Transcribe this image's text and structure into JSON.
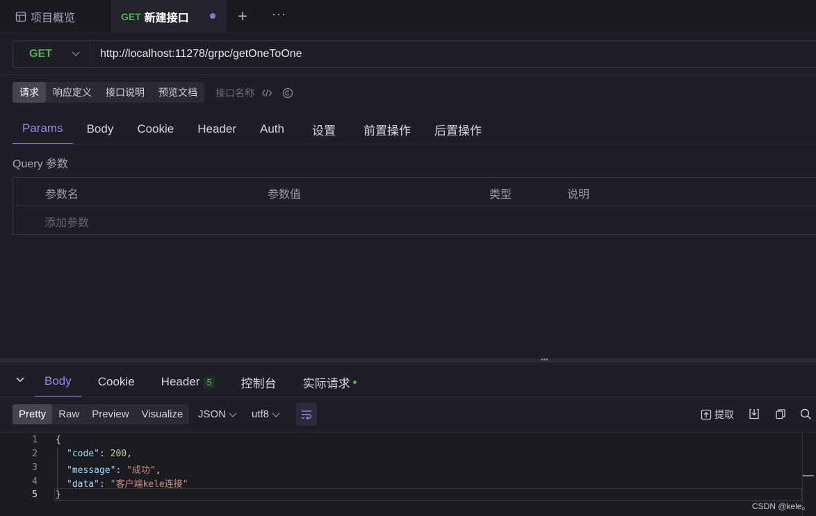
{
  "tabs": {
    "overview_label": "项目概览",
    "active_method": "GET",
    "active_name": "新建接口",
    "add_label": "+",
    "more_label": "···"
  },
  "request": {
    "method": "GET",
    "url": "http://localhost:11278/grpc/getOneToOne"
  },
  "segments": [
    "请求",
    "响应定义",
    "接口说明",
    "预览文档"
  ],
  "interface_name_placeholder": "接口名称",
  "param_tabs": [
    "Params",
    "Body",
    "Cookie",
    "Header",
    "Auth",
    "设置",
    "前置操作",
    "后置操作"
  ],
  "query_label": "Query 参数",
  "table": {
    "headers": [
      "参数名",
      "参数值",
      "类型",
      "说明"
    ],
    "add_placeholder": "添加参数"
  },
  "response": {
    "tabs": [
      "Body",
      "Cookie",
      "Header",
      "控制台",
      "实际请求"
    ],
    "header_count": "5",
    "format_tabs": [
      "Pretty",
      "Raw",
      "Preview",
      "Visualize"
    ],
    "format": "JSON",
    "encoding": "utf8",
    "extract_label": "提取",
    "lines": [
      "1",
      "2",
      "3",
      "4",
      "5"
    ],
    "code": {
      "open": "{",
      "k1": "\"code\"",
      "v1": "200",
      "k2": "\"message\"",
      "v2": "\"成功\"",
      "k3": "\"data\"",
      "v3": "\"客户端kele连接\"",
      "close": "}"
    }
  },
  "watermark": "CSDN @kele。",
  "colors": {
    "accent": "#8b72d8",
    "method_green": "#4fb34f",
    "bg": "#1e1e26"
  }
}
